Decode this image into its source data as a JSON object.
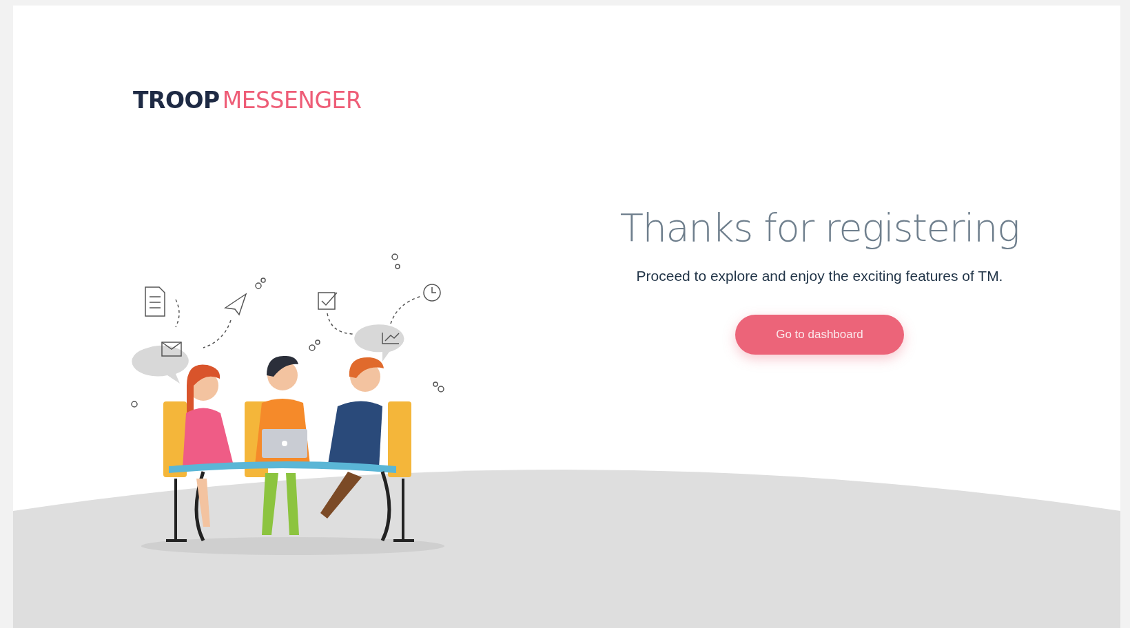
{
  "logo": {
    "first_word": "TROOP",
    "second_word": "MESSENGER"
  },
  "heading": "Thanks for registering",
  "subtitle": "Proceed to explore and enjoy the exciting features of TM.",
  "button": {
    "label": "Go to dashboard"
  }
}
